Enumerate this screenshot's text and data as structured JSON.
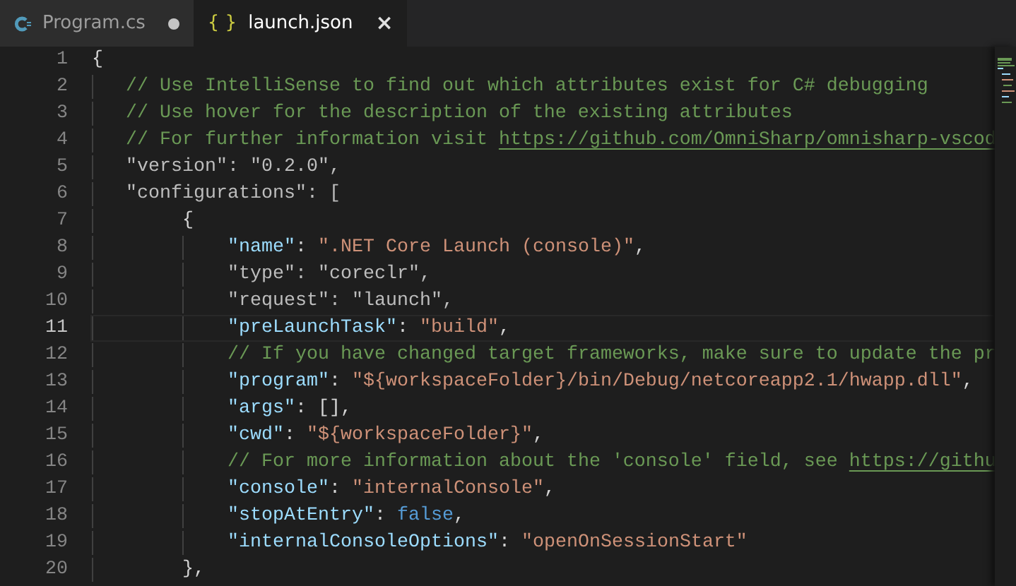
{
  "tabs": [
    {
      "kind": "csharp",
      "label": "Program.cs",
      "selected": false,
      "modified": true
    },
    {
      "kind": "json",
      "icon_text": "{ }",
      "label": "launch.json",
      "selected": true,
      "modified": false,
      "close": "×"
    }
  ],
  "lines": [
    {
      "number": "1",
      "current": false,
      "tokens": [
        {
          "kind": "punct",
          "text": "{"
        }
      ],
      "children": [
        {
          "number": "2",
          "current": false,
          "tokens": [
            {
              "kind": "comment",
              "text": "// Use IntelliSense to find out which attributes exist for C# debugging"
            }
          ]
        },
        {
          "number": "3",
          "current": false,
          "tokens": [
            {
              "kind": "comment",
              "text": "// Use hover for the description of the existing attributes"
            }
          ]
        },
        {
          "number": "4",
          "current": false,
          "tokens": [
            {
              "kind": "comment",
              "text": "// For further information visit"
            },
            {
              "kind": "link",
              "text": "https://github.com/OmniSharp/omnisharp-vscod"
            }
          ]
        },
        {
          "number": "5",
          "current": false,
          "tokens": [
            {
              "kind": "dim",
              "text": "\"version\": \"0.2.0\","
            }
          ]
        },
        {
          "number": "6",
          "current": false,
          "tokens": [
            {
              "kind": "dim",
              "text": "\"configurations\": ["
            }
          ],
          "children": [
            {
              "number": "7",
              "current": false,
              "tokens": [
                {
                  "kind": "punct",
                  "text": "{"
                }
              ],
              "children": [
                {
                  "number": "8",
                  "current": false,
                  "tokens": [
                    {
                      "kind": "key",
                      "text": "\"name\""
                    },
                    {
                      "kind": "punct",
                      "text": ": "
                    },
                    {
                      "kind": "string",
                      "text": "\".NET Core Launch (console)\""
                    },
                    {
                      "kind": "punct",
                      "text": ","
                    }
                  ]
                },
                {
                  "number": "9",
                  "current": false,
                  "tokens": [
                    {
                      "kind": "dim",
                      "text": "\"type\": \"coreclr\","
                    }
                  ]
                },
                {
                  "number": "10",
                  "current": false,
                  "tokens": [
                    {
                      "kind": "dim",
                      "text": "\"request\": \"launch\","
                    }
                  ]
                },
                {
                  "number": "11",
                  "current": true,
                  "tokens": [
                    {
                      "kind": "key",
                      "text": "\"preLaunchTask\""
                    },
                    {
                      "kind": "punct",
                      "text": ": "
                    },
                    {
                      "kind": "string",
                      "text": "\"build\""
                    },
                    {
                      "kind": "punct",
                      "text": ","
                    }
                  ]
                },
                {
                  "number": "12",
                  "current": false,
                  "tokens": [
                    {
                      "kind": "comment",
                      "text": "// If you have changed target frameworks, make sure to update the pr"
                    }
                  ]
                },
                {
                  "number": "13",
                  "current": false,
                  "tokens": [
                    {
                      "kind": "key",
                      "text": "\"program\""
                    },
                    {
                      "kind": "punct",
                      "text": ": "
                    },
                    {
                      "kind": "string",
                      "text": "\"${workspaceFolder}/bin/Debug/netcoreapp2.1/hwapp.dll\""
                    },
                    {
                      "kind": "punct",
                      "text": ","
                    }
                  ]
                },
                {
                  "number": "14",
                  "current": false,
                  "tokens": [
                    {
                      "kind": "key",
                      "text": "\"args\""
                    },
                    {
                      "kind": "punct",
                      "text": ": [],"
                    }
                  ]
                },
                {
                  "number": "15",
                  "current": false,
                  "tokens": [
                    {
                      "kind": "key",
                      "text": "\"cwd\""
                    },
                    {
                      "kind": "punct",
                      "text": ": "
                    },
                    {
                      "kind": "string",
                      "text": "\"${workspaceFolder}\""
                    },
                    {
                      "kind": "punct",
                      "text": ","
                    }
                  ]
                },
                {
                  "number": "16",
                  "current": false,
                  "tokens": [
                    {
                      "kind": "comment",
                      "text": "// For more information about the 'console' field, see"
                    },
                    {
                      "kind": "link",
                      "text": "https://githu"
                    }
                  ]
                },
                {
                  "number": "17",
                  "current": false,
                  "tokens": [
                    {
                      "kind": "key",
                      "text": "\"console\""
                    },
                    {
                      "kind": "punct",
                      "text": ": "
                    },
                    {
                      "kind": "string",
                      "text": "\"internalConsole\""
                    },
                    {
                      "kind": "punct",
                      "text": ","
                    }
                  ]
                },
                {
                  "number": "18",
                  "current": false,
                  "tokens": [
                    {
                      "kind": "key",
                      "text": "\"stopAtEntry\""
                    },
                    {
                      "kind": "punct",
                      "text": ": "
                    },
                    {
                      "kind": "bool",
                      "text": "false"
                    },
                    {
                      "kind": "punct",
                      "text": ","
                    }
                  ]
                },
                {
                  "number": "19",
                  "current": false,
                  "tokens": [
                    {
                      "kind": "key",
                      "text": "\"internalConsoleOptions\""
                    },
                    {
                      "kind": "punct",
                      "text": ": "
                    },
                    {
                      "kind": "string",
                      "text": "\"openOnSessionStart\""
                    }
                  ]
                }
              ]
            },
            {
              "number": "20",
              "current": false,
              "tokens": [
                {
                  "kind": "punct",
                  "text": "},"
                }
              ]
            }
          ]
        }
      ]
    }
  ]
}
